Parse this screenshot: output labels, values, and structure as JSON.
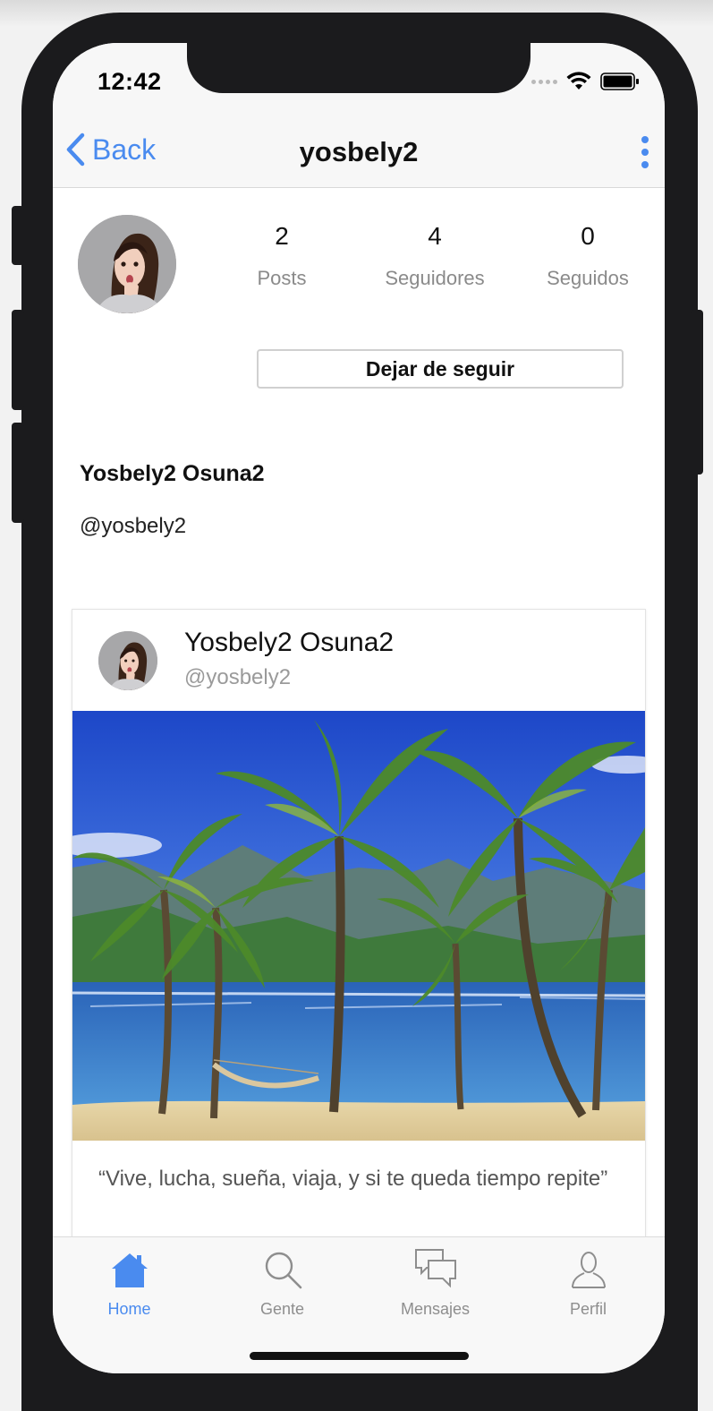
{
  "status_bar": {
    "time": "12:42"
  },
  "nav": {
    "back_label": "Back",
    "title": "yosbely2"
  },
  "profile": {
    "stats": [
      {
        "value": "2",
        "label": "Posts"
      },
      {
        "value": "4",
        "label": "Seguidores"
      },
      {
        "value": "0",
        "label": "Seguidos"
      }
    ],
    "follow_button": "Dejar de seguir",
    "full_name": "Yosbely2 Osuna2",
    "handle": "@yosbely2"
  },
  "post": {
    "author_name": "Yosbely2 Osuna2",
    "author_handle": "@yosbely2",
    "caption": "“Vive, lucha, sueña, viaja, y si te queda tiempo repite”"
  },
  "tabbar": {
    "items": [
      {
        "label": "Home",
        "icon": "home-icon",
        "active": true
      },
      {
        "label": "Gente",
        "icon": "search-icon",
        "active": false
      },
      {
        "label": "Mensajes",
        "icon": "messages-icon",
        "active": false
      },
      {
        "label": "Perfil",
        "icon": "person-icon",
        "active": false
      }
    ]
  },
  "colors": {
    "accent": "#4a8bef",
    "device": "#1b1b1d"
  }
}
